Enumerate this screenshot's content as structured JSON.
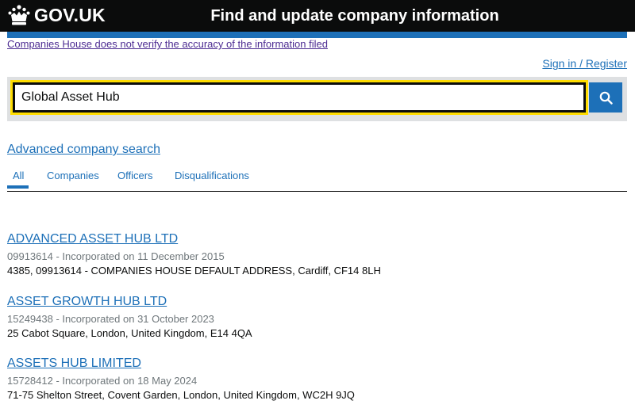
{
  "header": {
    "logo_text": "GOV.UK",
    "logo_icon": "crown-icon",
    "service_name": "Find and update company information"
  },
  "banner": {
    "disclaimer": "Companies House does not verify the accuracy of the information filed"
  },
  "account": {
    "sign_in_label": "Sign in / Register"
  },
  "search": {
    "value": "Global Asset Hub",
    "button_icon": "search-icon"
  },
  "advanced_search_label": "Advanced company search",
  "tabs": [
    {
      "label": "All",
      "active": true
    },
    {
      "label": "Companies",
      "active": false
    },
    {
      "label": "Officers",
      "active": false
    },
    {
      "label": "Disqualifications",
      "active": false
    }
  ],
  "results": [
    {
      "name": "ADVANCED ASSET HUB LTD",
      "meta": "09913614 - Incorporated on 11 December 2015",
      "address": "4385, 09913614 - COMPANIES HOUSE DEFAULT ADDRESS, Cardiff, CF14 8LH"
    },
    {
      "name": "ASSET GROWTH HUB LTD",
      "meta": "15249438 - Incorporated on 31 October 2023",
      "address": "25 Cabot Square, London, United Kingdom, E14 4QA"
    },
    {
      "name": "ASSETS HUB LIMITED",
      "meta": "15728412 - Incorporated on 18 May 2024",
      "address": "71-75 Shelton Street, Covent Garden, London, United Kingdom, WC2H 9JQ"
    }
  ],
  "colors": {
    "header_bg": "#0b0c0c",
    "link": "#1d70b8",
    "visited_link": "#4c2c92",
    "focus": "#ffdd00",
    "panel_bg": "#dee0e2",
    "secondary_text": "#6f777b"
  }
}
